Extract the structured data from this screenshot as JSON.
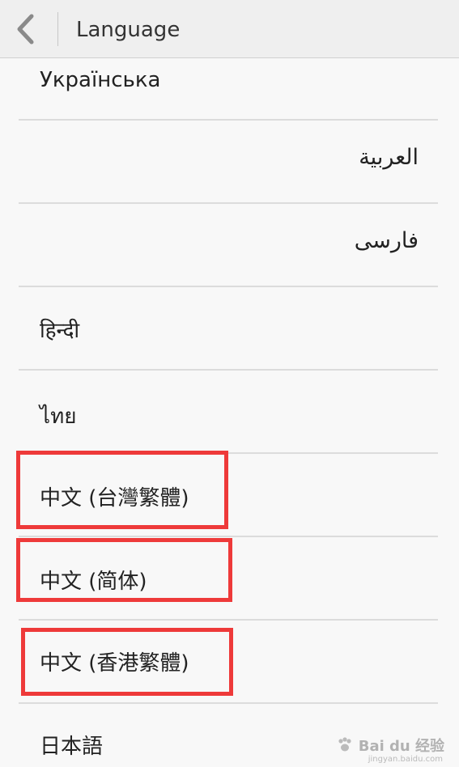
{
  "header": {
    "title": "Language",
    "back_icon": "chevron-left-icon"
  },
  "languages": [
    {
      "label": "Українська"
    },
    {
      "label": "العربية"
    },
    {
      "label": "فارسی"
    },
    {
      "label": "हिन्दी"
    },
    {
      "label": "ไทย"
    },
    {
      "label": "中文 (台灣繁體)"
    },
    {
      "label": "中文 (简体)"
    },
    {
      "label": "中文 (香港繁體)"
    },
    {
      "label": "日本語"
    }
  ],
  "annotation": {
    "highlight_color": "#ee3a3a"
  },
  "watermark": {
    "text": "Bai du 经验",
    "subtext": "jingyan.baidu.com"
  }
}
